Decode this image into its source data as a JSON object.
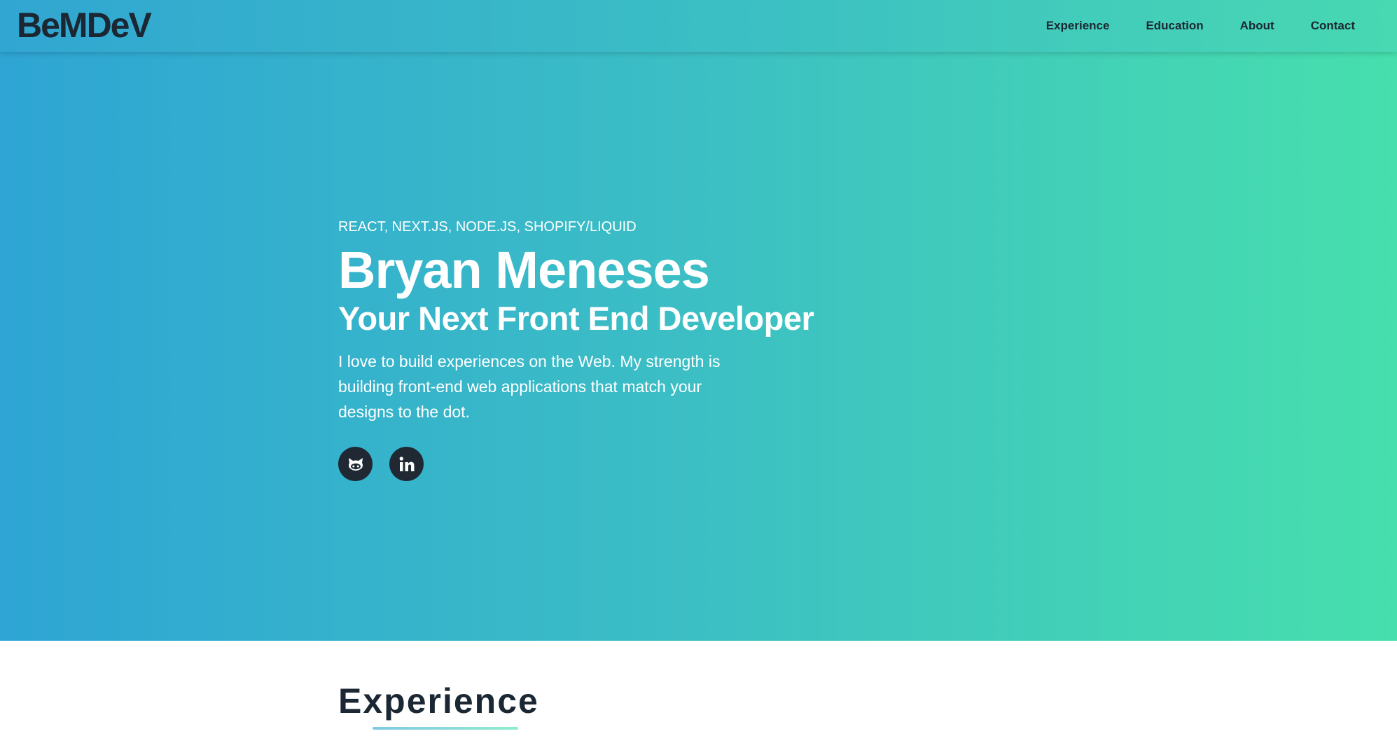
{
  "navbar": {
    "logo": "BeMDeV",
    "links": [
      {
        "label": "Experience"
      },
      {
        "label": "Education"
      },
      {
        "label": "About"
      },
      {
        "label": "Contact"
      }
    ]
  },
  "hero": {
    "tagline": "REACT, NEXT.JS, NODE.JS, SHOPIFY/LIQUID",
    "name": "Bryan Meneses",
    "subtitle": "Your Next Front End Developer",
    "description": "I love to build experiences on the Web. My strength is building front-end web applications that match your designs to the dot.",
    "socials": [
      {
        "icon": "github-icon"
      },
      {
        "icon": "linkedin-icon"
      }
    ]
  },
  "sections": {
    "experience_title": "Experience"
  },
  "colors": {
    "gradient_start": "#2ea5d4",
    "gradient_end": "#47dfad",
    "dark_text": "#1b2733",
    "social_bg": "#1f2833"
  }
}
